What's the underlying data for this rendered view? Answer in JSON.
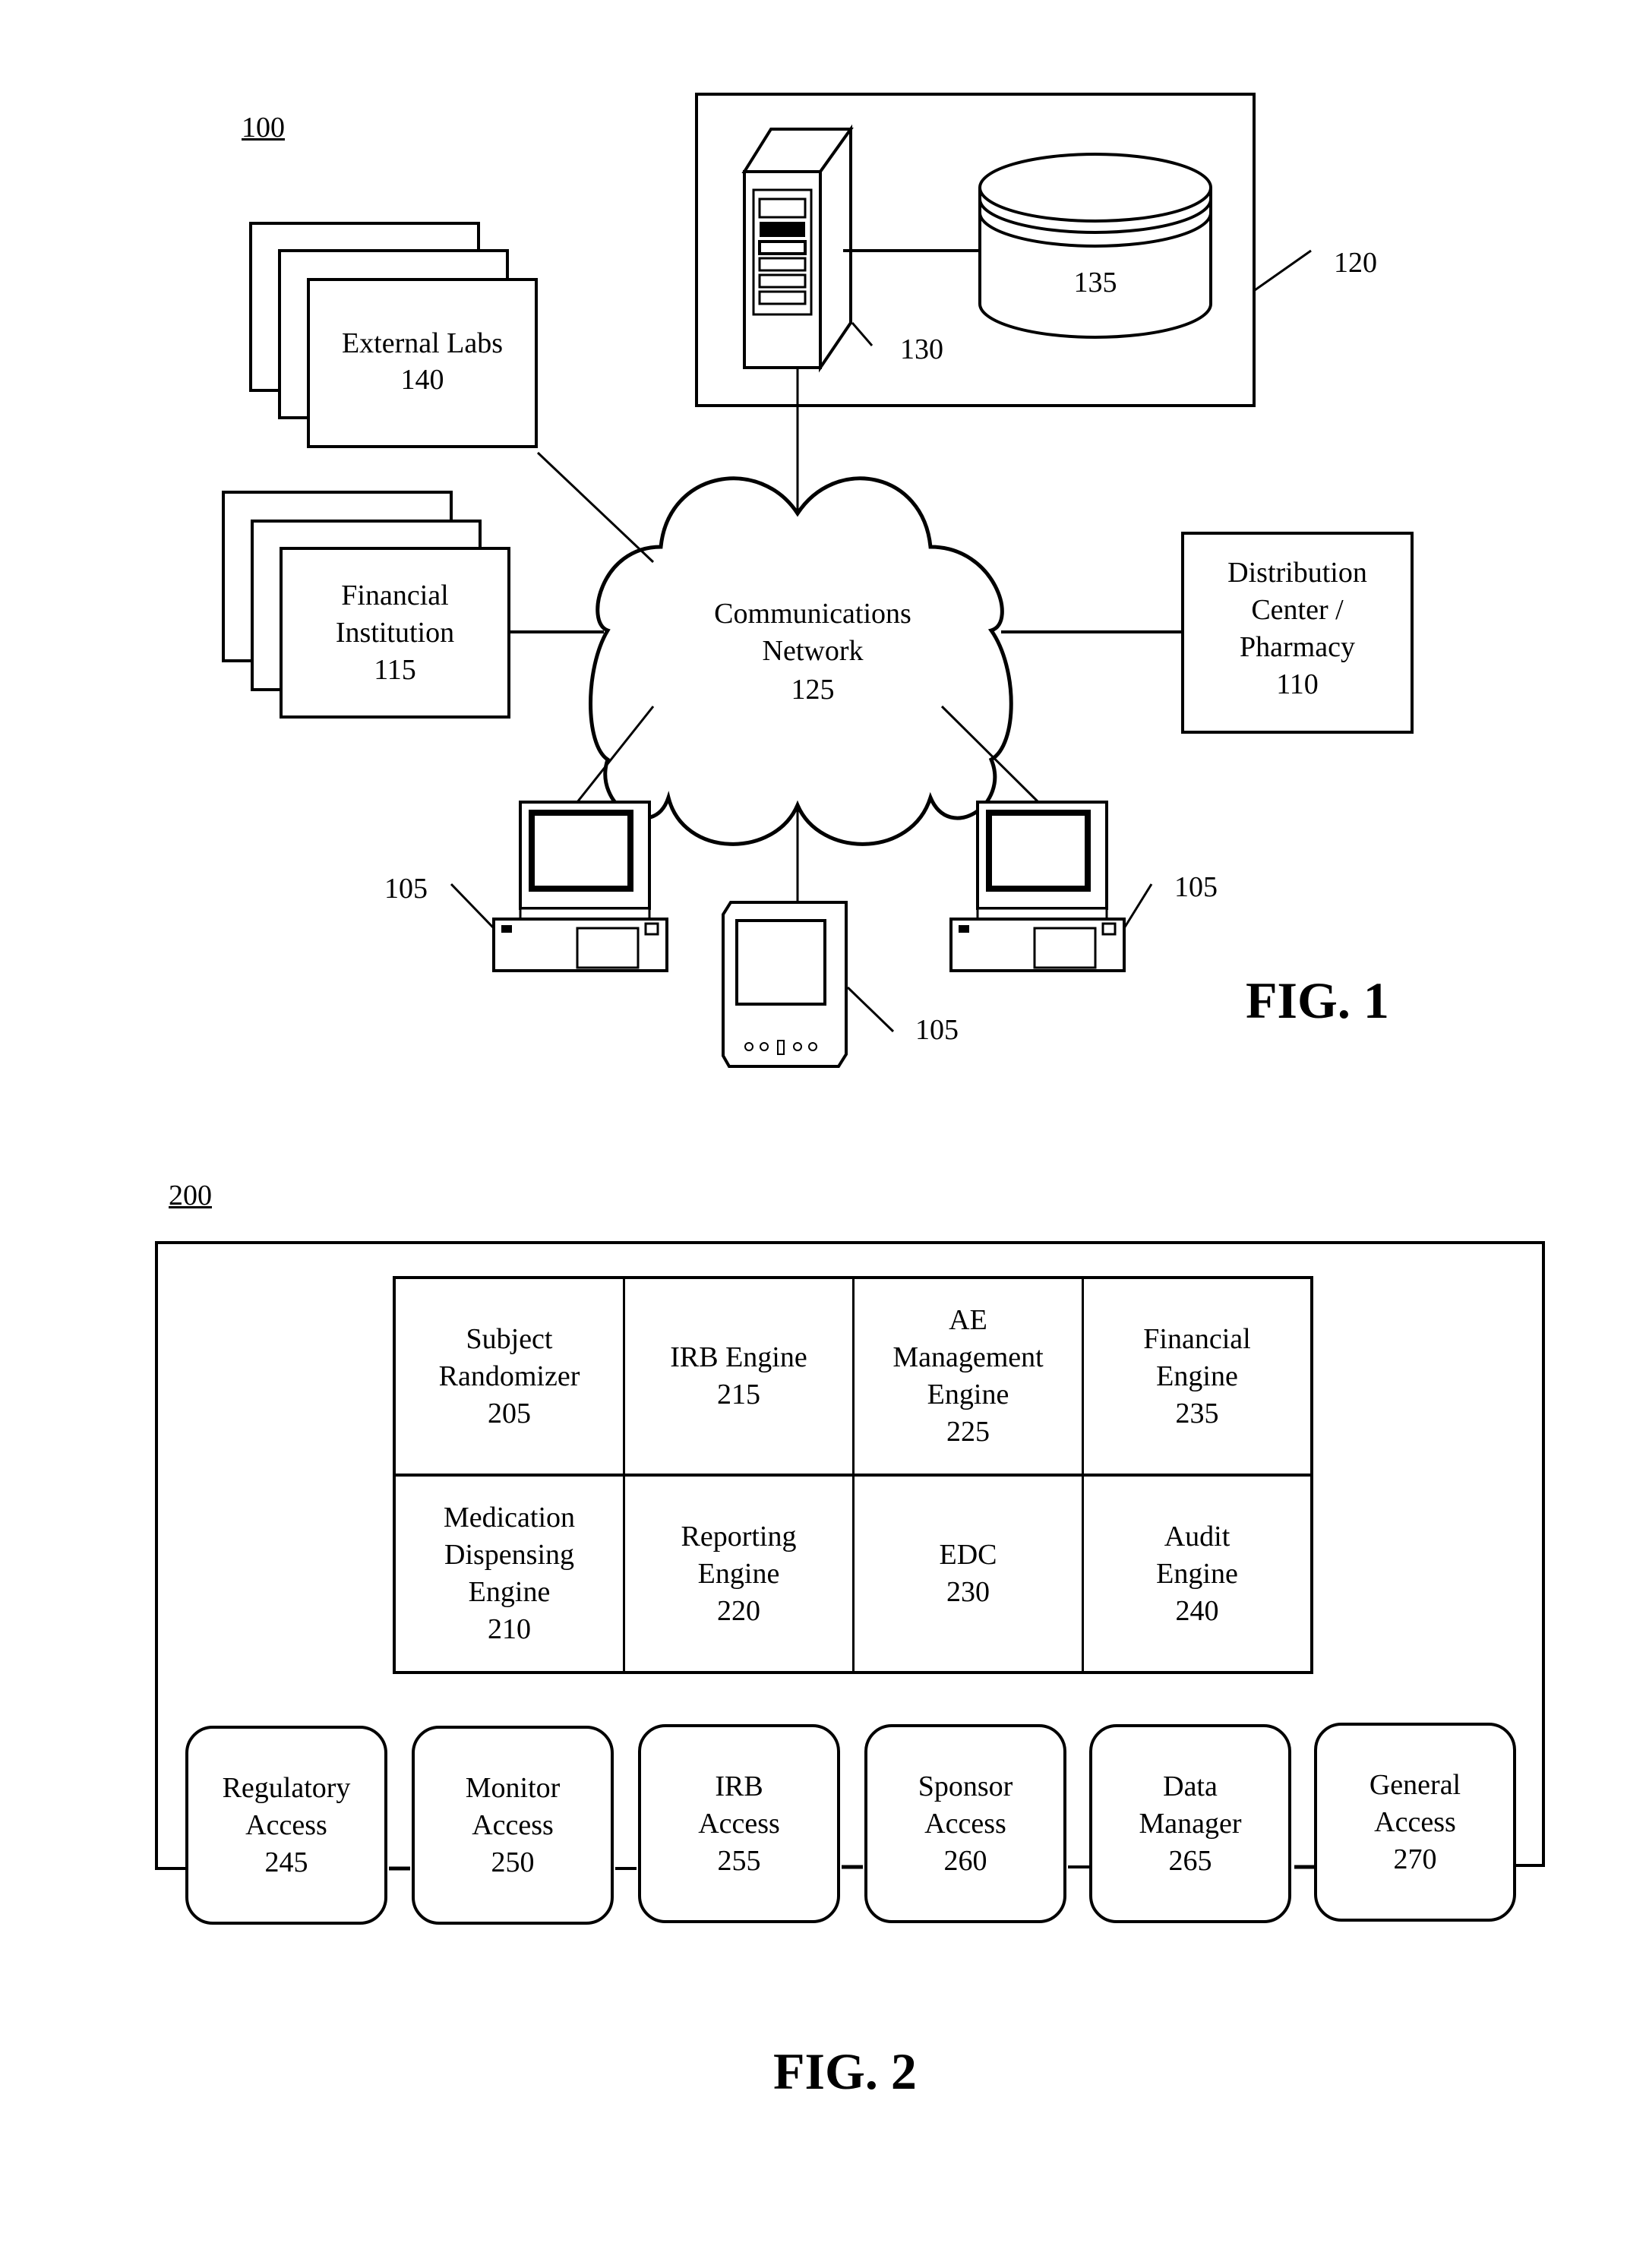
{
  "fig1": {
    "ref_label": "100",
    "title": "FIG. 1",
    "external_labs": {
      "name": "External Labs",
      "ref": "140"
    },
    "financial_institution": {
      "name": "Financial\nInstitution",
      "ref": "115"
    },
    "distribution_center": {
      "name": "Distribution\nCenter /\nPharmacy",
      "ref": "110"
    },
    "network": {
      "name": "Communications\nNetwork",
      "ref": "125"
    },
    "server_system_ref": "120",
    "server_ref": "130",
    "database_ref": "135",
    "client_device_ref": "105",
    "client_devices": [
      "desktop computer",
      "handheld device",
      "desktop computer"
    ]
  },
  "fig2": {
    "ref_label": "200",
    "title": "FIG. 2",
    "engines": [
      {
        "name": "Subject\nRandomizer",
        "ref": "205"
      },
      {
        "name": "IRB Engine",
        "ref": "215"
      },
      {
        "name": "AE\nManagement\nEngine",
        "ref": "225"
      },
      {
        "name": "Financial\nEngine",
        "ref": "235"
      },
      {
        "name": "Medication\nDispensing\nEngine",
        "ref": "210"
      },
      {
        "name": "Reporting\nEngine",
        "ref": "220"
      },
      {
        "name": "EDC",
        "ref": "230"
      },
      {
        "name": "Audit\nEngine",
        "ref": "240"
      }
    ],
    "access_modules": [
      {
        "name": "Regulatory\nAccess",
        "ref": "245"
      },
      {
        "name": "Monitor\nAccess",
        "ref": "250"
      },
      {
        "name": "IRB\nAccess",
        "ref": "255"
      },
      {
        "name": "Sponsor\nAccess",
        "ref": "260"
      },
      {
        "name": "Data\nManager",
        "ref": "265"
      },
      {
        "name": "General\nAccess",
        "ref": "270"
      }
    ]
  }
}
